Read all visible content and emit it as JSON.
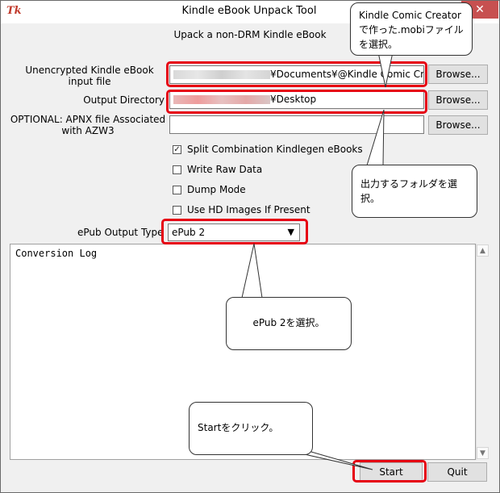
{
  "window": {
    "title": "Kindle eBook Unpack Tool",
    "app_icon": "Tk",
    "close_glyph": "✕",
    "subtitle": "Upack a non-DRM Kindle eBook"
  },
  "form": {
    "input_label": "Unencrypted Kindle eBook input file",
    "input_value": "¥Documents¥@Kindle Comic Crea",
    "output_label": "Output Directory",
    "output_value": "¥Desktop",
    "apnx_label": "OPTIONAL: APNX file Associated with AZW3",
    "apnx_value": "",
    "browse_label": "Browse..."
  },
  "options": [
    {
      "label": "Split Combination Kindlegen eBooks",
      "checked": true
    },
    {
      "label": "Write Raw Data",
      "checked": false
    },
    {
      "label": "Dump Mode",
      "checked": false
    },
    {
      "label": "Use HD Images If Present",
      "checked": false
    }
  ],
  "epub": {
    "label": "ePub Output Type",
    "selected": "ePub 2"
  },
  "log": {
    "text": "Conversion Log"
  },
  "actions": {
    "start_label": "Start",
    "quit_label": "Quit"
  },
  "annotations": {
    "callout_mobi": "Kindle Comic Creatorで作った.mobiファイルを選択。",
    "callout_folder": "出力するフォルダを選択。",
    "callout_epub": "ePub 2を選択。",
    "callout_start": "Startをクリック。"
  },
  "colors": {
    "highlight": "#e60012",
    "close_button": "#c75050"
  }
}
